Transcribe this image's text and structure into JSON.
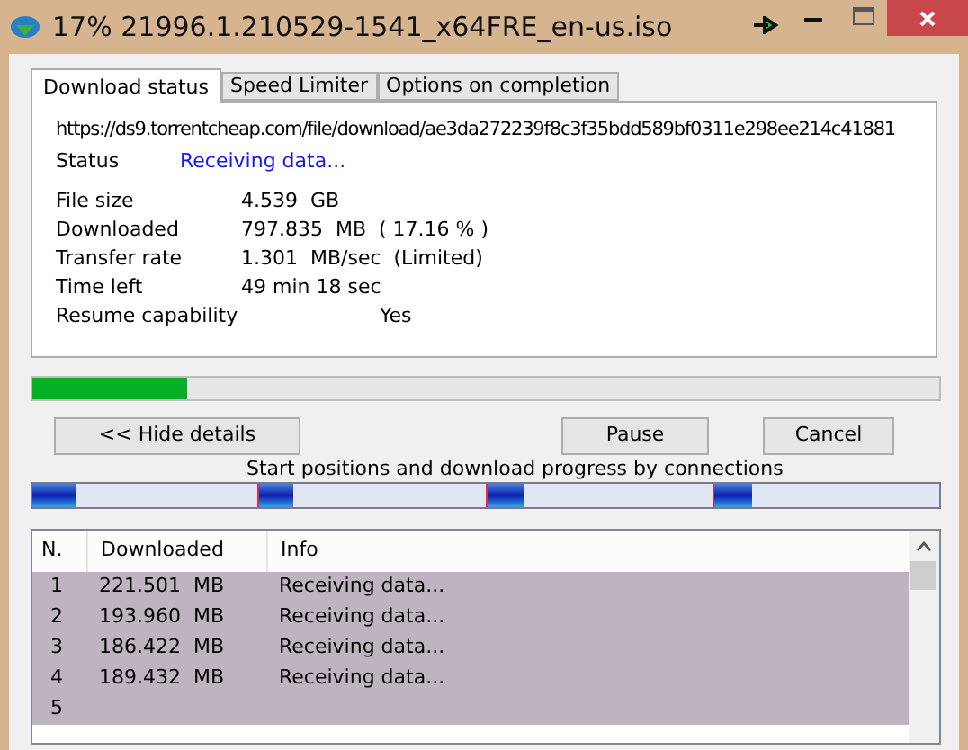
{
  "window": {
    "title": "17% 21996.1.210529-1541_x64FRE_en-us.iso"
  },
  "tabs": [
    {
      "label": "Download status",
      "selected": true
    },
    {
      "label": "Speed Limiter",
      "selected": false
    },
    {
      "label": "Options on completion",
      "selected": false
    }
  ],
  "url": "https://ds9.torrentcheap.com/file/download/ae3da272239f8c3f35bdd589bf0311e298ee214c41881",
  "status": {
    "label": "Status",
    "value": "Receiving data..."
  },
  "details": [
    {
      "label": "File size",
      "value": "4.539  GB"
    },
    {
      "label": "Downloaded",
      "value": "797.835  MB  ( 17.16 % )"
    },
    {
      "label": "Transfer rate",
      "value": "1.301  MB/sec  (Limited)"
    },
    {
      "label": "Time left",
      "value": "49 min 18 sec"
    }
  ],
  "resume": {
    "label": "Resume capability",
    "value": "Yes"
  },
  "progress": {
    "level": 0.1716
  },
  "buttons": {
    "hide": "<< Hide details",
    "pause": "Pause",
    "cancel": "Cancel"
  },
  "connections_caption": "Start positions and download progress by connections",
  "connections": [
    {
      "level": 0.19
    },
    {
      "level": 0.15
    },
    {
      "level": 0.16
    },
    {
      "level": 0.17
    }
  ],
  "table": {
    "columns": [
      "N.",
      "Downloaded",
      "Info"
    ],
    "rows": [
      {
        "n": "1",
        "downloaded": "221.501  MB",
        "info": "Receiving data...",
        "selected": true
      },
      {
        "n": "2",
        "downloaded": "193.960  MB",
        "info": "Receiving data...",
        "selected": true
      },
      {
        "n": "3",
        "downloaded": "186.422  MB",
        "info": "Receiving data...",
        "selected": true
      },
      {
        "n": "4",
        "downloaded": "189.432  MB",
        "info": "Receiving data...",
        "selected": true
      },
      {
        "n": "5",
        "selected": true
      }
    ]
  }
}
